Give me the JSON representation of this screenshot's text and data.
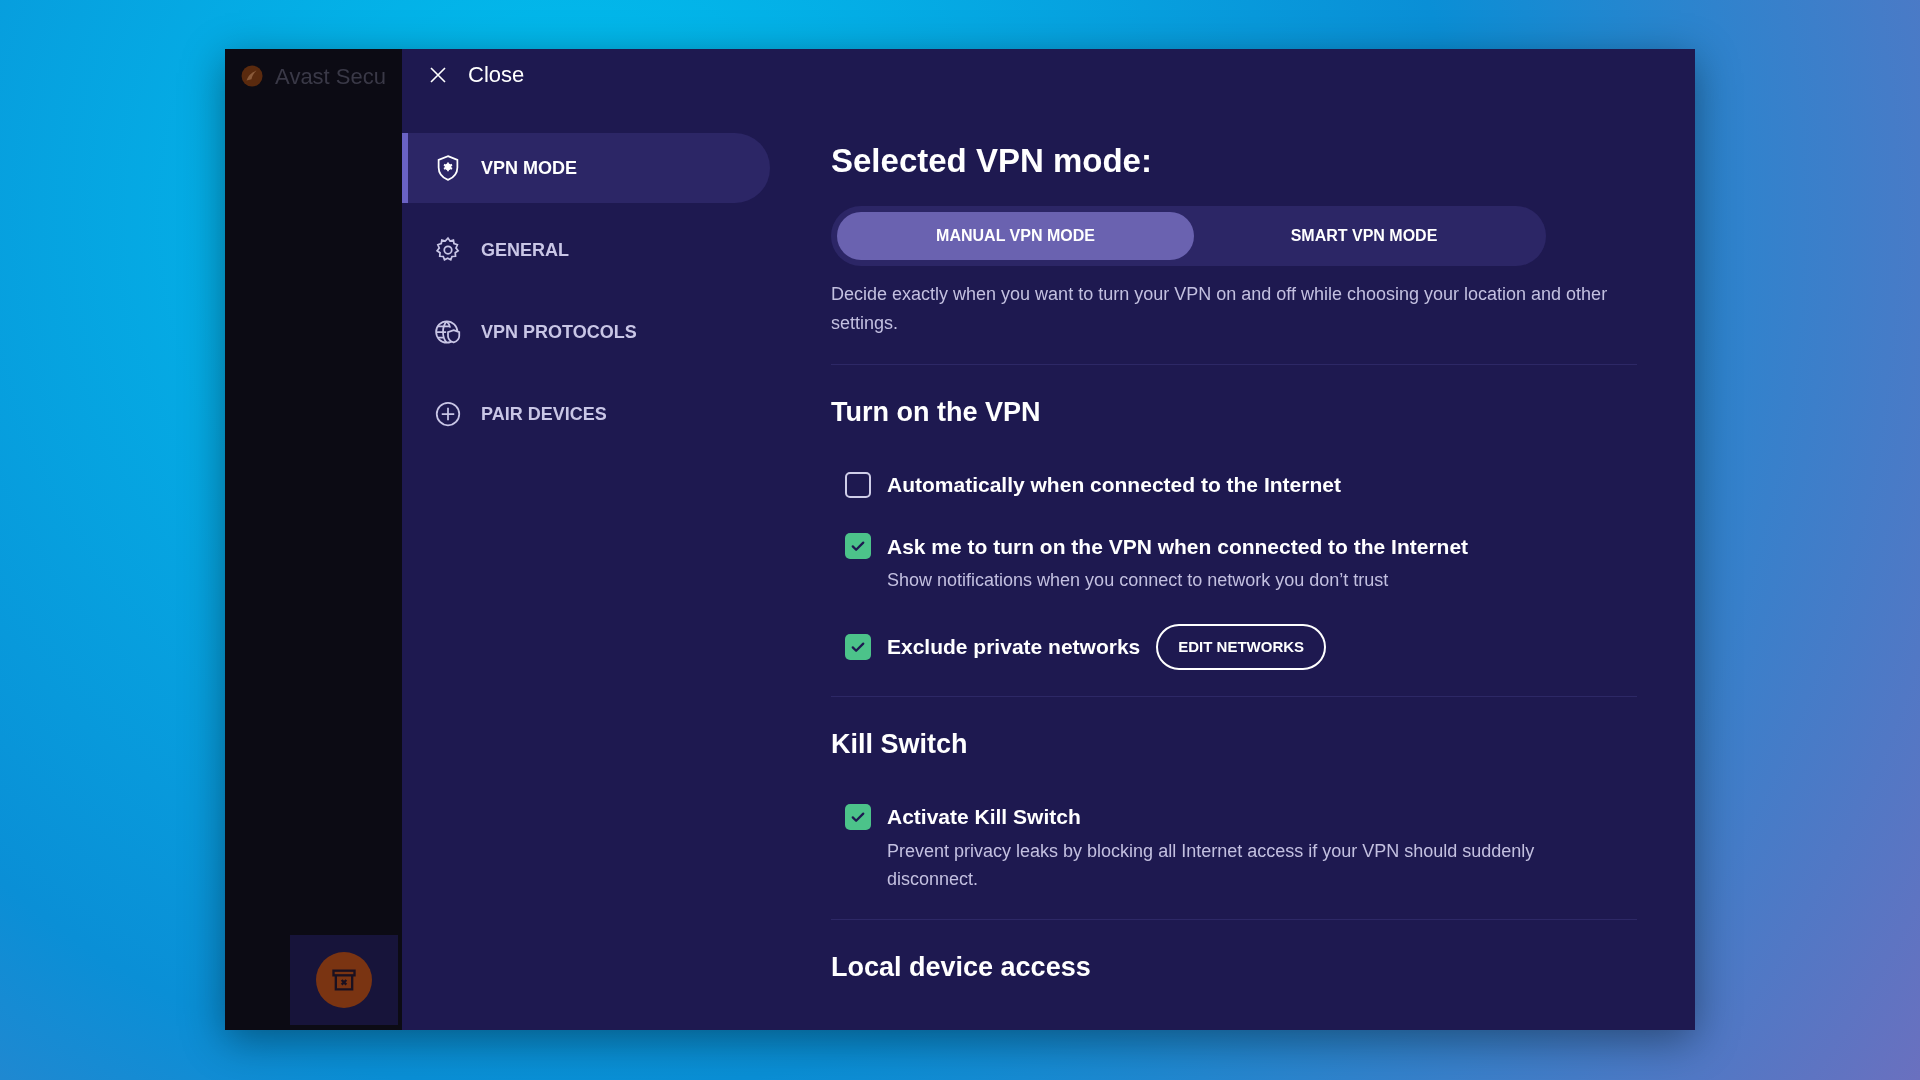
{
  "app": {
    "title": "Avast Secu"
  },
  "close": {
    "label": "Close"
  },
  "nav": [
    {
      "label": "VPN MODE",
      "selected": true
    },
    {
      "label": "GENERAL",
      "selected": false
    },
    {
      "label": "VPN PROTOCOLS",
      "selected": false
    },
    {
      "label": "PAIR DEVICES",
      "selected": false
    }
  ],
  "heading": "Selected VPN mode:",
  "modes": [
    {
      "label": "MANUAL VPN MODE",
      "selected": true
    },
    {
      "label": "SMART VPN MODE",
      "selected": false
    }
  ],
  "mode_description": "Decide exactly when you want to turn your VPN on and off while choosing your location and other settings.",
  "sections": [
    {
      "title": "Turn on the VPN",
      "options": [
        {
          "label": "Automatically when connected to the Internet",
          "checked": false
        },
        {
          "label": "Ask me to turn on the VPN when connected to the Internet",
          "checked": true,
          "description": "Show notifications when you connect to network you don’t trust"
        },
        {
          "label": "Exclude private networks",
          "checked": true,
          "button": "EDIT NETWORKS"
        }
      ]
    },
    {
      "title": "Kill Switch",
      "options": [
        {
          "label": "Activate Kill Switch",
          "checked": true,
          "description": "Prevent privacy leaks by blocking all Internet access if your VPN should suddenly disconnect."
        }
      ]
    },
    {
      "title": "Local device access"
    }
  ]
}
